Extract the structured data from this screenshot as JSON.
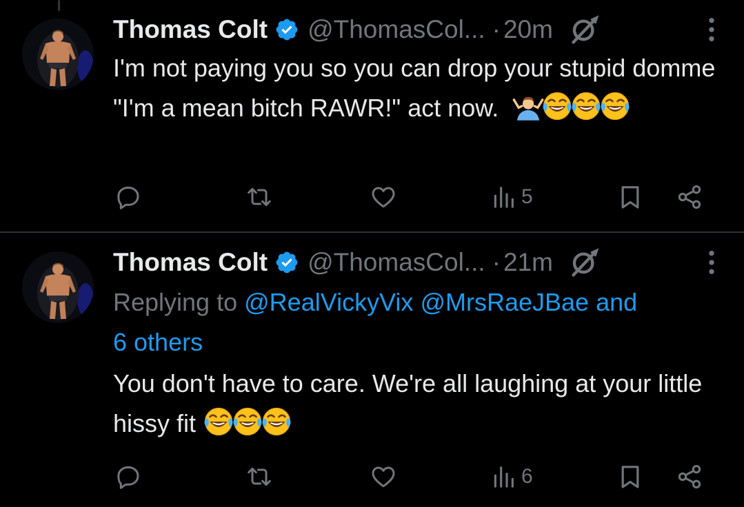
{
  "tweets": [
    {
      "author": {
        "name": "Thomas Colt",
        "handle": "@ThomasCol...",
        "avatar": "bodybuilder-avatar"
      },
      "time": "20m",
      "dot": "·",
      "text": "I'm not paying you so you can drop your stupid domme \"I'm a mean bitch RAWR!\" act now.",
      "emojis": [
        "person-shrugging",
        "face-with-tears-of-joy",
        "face-with-tears-of-joy",
        "face-with-tears-of-joy"
      ],
      "views": "5"
    },
    {
      "author": {
        "name": "Thomas Colt",
        "handle": "@ThomasCol...",
        "avatar": "bodybuilder-avatar"
      },
      "time": "21m",
      "dot": "·",
      "replying_prefix": "Replying to",
      "mentions": [
        "@RealVickyVix",
        "@MrsRaeJBae"
      ],
      "and_text": "and",
      "others_text": "6 others",
      "text": "You don't have to care. We're all laughing at your little hissy fit",
      "emojis": [
        "face-with-tears-of-joy",
        "face-with-tears-of-joy",
        "face-with-tears-of-joy"
      ],
      "views": "6"
    }
  ],
  "colors": {
    "background": "#000000",
    "text": "#e7e9ea",
    "muted": "#71767b",
    "accent": "#1d9bf0",
    "divider": "#2f3336"
  },
  "icons": [
    "verified-badge-icon",
    "grok-icon",
    "more-icon",
    "reply-icon",
    "repost-icon",
    "like-icon",
    "views-icon",
    "bookmark-icon",
    "share-icon"
  ]
}
